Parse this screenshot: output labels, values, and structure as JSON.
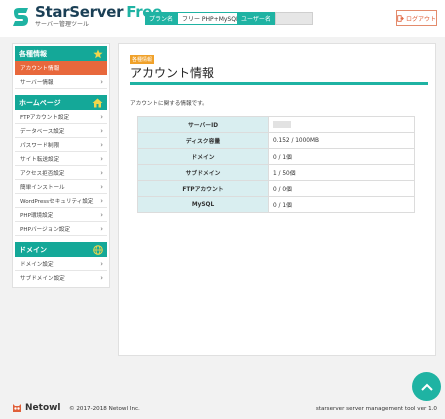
{
  "header": {
    "logo_name": "StarServer",
    "logo_free": "Free",
    "logo_sub": "サーバー管理ツール",
    "plan_label": "プラン名",
    "plan_value": "フリー PHP+MySQL",
    "user_label": "ユーザー名",
    "logout_label": "ログアウト"
  },
  "sidebar": {
    "sections": [
      {
        "title": "各種情報",
        "icon": "star-icon",
        "items": [
          {
            "label": "アカウント情報",
            "active": true
          },
          {
            "label": "サーバー情報",
            "active": false
          }
        ]
      },
      {
        "title": "ホームページ",
        "icon": "house-icon",
        "items": [
          {
            "label": "FTPアカウント設定"
          },
          {
            "label": "データベース設定"
          },
          {
            "label": "パスワード制限"
          },
          {
            "label": "サイト転送設定"
          },
          {
            "label": "アクセス拒否設定"
          },
          {
            "label": "簡単インストール"
          },
          {
            "label": "WordPressセキュリティ設定"
          },
          {
            "label": "PHP環境設定"
          },
          {
            "label": "PHPバージョン設定"
          }
        ]
      },
      {
        "title": "ドメイン",
        "icon": "globe-icon",
        "items": [
          {
            "label": "ドメイン設定"
          },
          {
            "label": "サブドメイン設定"
          }
        ]
      }
    ]
  },
  "main": {
    "badge": "各種情報",
    "title": "アカウント情報",
    "description": "アカウントに関する情報です。",
    "rows": [
      {
        "key": "サーバーID",
        "value": ""
      },
      {
        "key": "ディスク容量",
        "value": "0.152 / 1000MB"
      },
      {
        "key": "ドメイン",
        "value": "0 / 1個"
      },
      {
        "key": "サブドメイン",
        "value": "1 / 50個"
      },
      {
        "key": "FTPアカウント",
        "value": "0 / 0個"
      },
      {
        "key": "MySQL",
        "value": "0 / 1個"
      }
    ]
  },
  "footer": {
    "brand": "Netowl",
    "copyright": "© 2017-2018 Netowl Inc.",
    "version": "starserver server management tool ver 1.0"
  },
  "colors": {
    "accent": "#1fb3a3",
    "sidebar_head": "#14a898",
    "active": "#e8683c",
    "logout": "#e0603a",
    "badge": "#f0a12a"
  }
}
